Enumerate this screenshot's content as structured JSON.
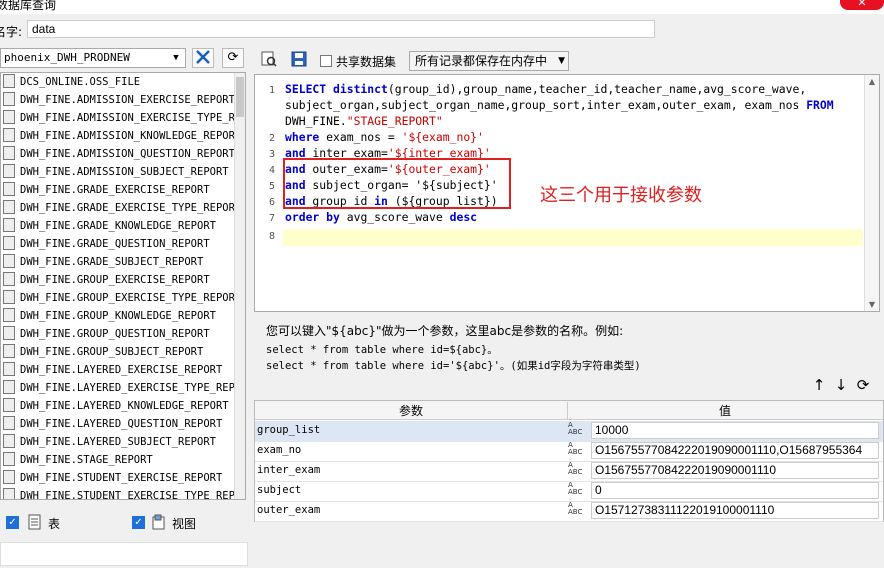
{
  "window": {
    "title": "数据库查询"
  },
  "name_row": {
    "label": "名字:",
    "value": "data"
  },
  "left": {
    "connection": "phoenix_DWH_PRODNEW",
    "tables": [
      "DCS_ONLINE.OSS_FILE",
      "DWH_FINE.ADMISSION_EXERCISE_REPORT",
      "DWH_FINE.ADMISSION_EXERCISE_TYPE_REPO",
      "DWH_FINE.ADMISSION_KNOWLEDGE_REPORT",
      "DWH_FINE.ADMISSION_QUESTION_REPORT",
      "DWH_FINE.ADMISSION_SUBJECT_REPORT",
      "DWH_FINE.GRADE_EXERCISE_REPORT",
      "DWH_FINE.GRADE_EXERCISE_TYPE_REPORT",
      "DWH_FINE.GRADE_KNOWLEDGE_REPORT",
      "DWH_FINE.GRADE_QUESTION_REPORT",
      "DWH_FINE.GRADE_SUBJECT_REPORT",
      "DWH_FINE.GROUP_EXERCISE_REPORT",
      "DWH_FINE.GROUP_EXERCISE_TYPE_REPORT",
      "DWH_FINE.GROUP_KNOWLEDGE_REPORT",
      "DWH_FINE.GROUP_QUESTION_REPORT",
      "DWH_FINE.GROUP_SUBJECT_REPORT",
      "DWH_FINE.LAYERED_EXERCISE_REPORT",
      "DWH_FINE.LAYERED_EXERCISE_TYPE_REPORT",
      "DWH_FINE.LAYERED_KNOWLEDGE_REPORT",
      "DWH_FINE.LAYERED_QUESTION_REPORT",
      "DWH_FINE.LAYERED_SUBJECT_REPORT",
      "DWH_FINE.STAGE_REPORT",
      "DWH_FINE.STUDENT_EXERCISE_REPORT",
      "DWH_FINE.STUDENT_EXERCISE_TYPE_REPORT"
    ],
    "check_table": "表",
    "check_view": "视图"
  },
  "toolbar": {
    "shared_dataset": "共享数据集",
    "mode": "所有记录都保存在内存中"
  },
  "editor": {
    "line_numbers": [
      "1",
      "2",
      "3",
      "4",
      "5",
      "6",
      "7",
      "8"
    ],
    "lines": {
      "l1a_kw": "SELECT distinct",
      "l1a": "(group_id),group_name,teacher_id,teacher_name,avg_score_wave,",
      "l1b": "subject_organ,subject_organ_name,group_sort,inter_exam,outer_exam, exam_nos  ",
      "l1b_kw": "FROM",
      "l1c": "DWH_FINE.",
      "l1c_str": "\"STAGE_REPORT\"",
      "l2_kw": "where",
      "l2": " exam_nos = ",
      "l2_str": "'${exam_no}'",
      "l3_kw": "and",
      "l3": " inter_exam=",
      "l3_str": "'${inter_exam}'",
      "l4_kw": "and",
      "l4": " outer_exam=",
      "l4_str": "'${outer_exam}'",
      "l5_kw": "and",
      "l5": " subject_organ= '${subject}'",
      "l6_kw": "and",
      "l6": " group_id ",
      "l6_kw2": "in",
      "l6b": " (${group_list})",
      "l7_kw": "order by",
      "l7": " avg_score_wave ",
      "l7_kw2": "desc"
    },
    "annotation": "这三个用于接收参数"
  },
  "help": {
    "line1": "您可以键入\"${abc}\"做为一个参数，这里abc是参数的名称。例如:",
    "line2": "select * from table where id=${abc}。",
    "line3": "select * from table where id='${abc}'。(如果id字段为字符串类型)"
  },
  "params": {
    "col_name": "参数",
    "col_value": "值",
    "rows": [
      {
        "name": "group_list",
        "value": "10000"
      },
      {
        "name": "exam_no",
        "value": "O156755770842220190900011​10,O15687955364"
      },
      {
        "name": "inter_exam",
        "value": "O15675577084222019090001110"
      },
      {
        "name": "subject",
        "value": "0"
      },
      {
        "name": "outer_exam",
        "value": "O15712738311122019100001110"
      }
    ]
  }
}
